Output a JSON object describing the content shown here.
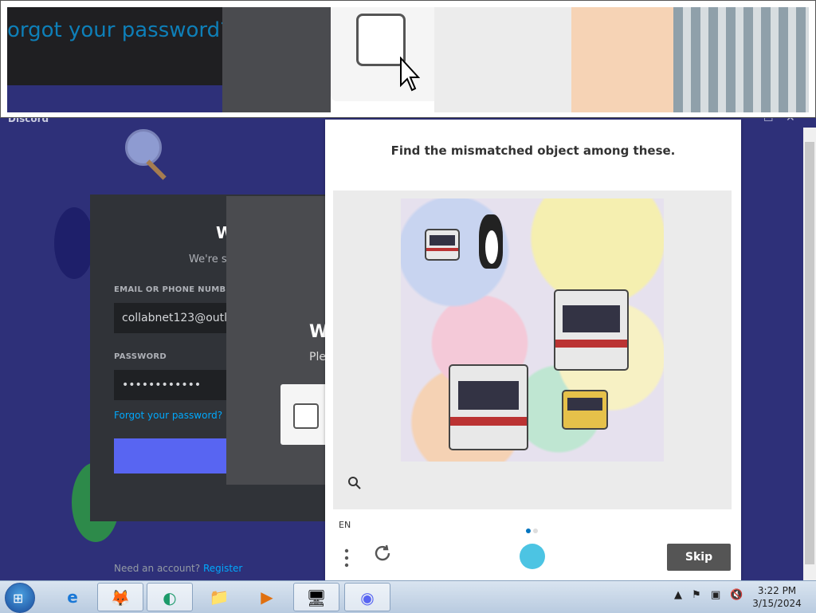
{
  "discord": {
    "window_title": "Discord",
    "login": {
      "title": "W",
      "subtitle": "We're s",
      "email_label": "EMAIL OR PHONE NUMB",
      "email_value": "collabnet123@outl",
      "password_label": "PASSWORD",
      "password_value": "••••••••••••",
      "forgot_link": "Forgot your password?",
      "need_account": "Need an account?",
      "register_link": "Register"
    },
    "hcaptcha_overlay": {
      "title": "W",
      "subtitle": "Ple"
    }
  },
  "zoom_strip": {
    "forgot_text": "orgot your password?"
  },
  "challenge": {
    "prompt": "Find the mismatched object among these.",
    "language": "EN",
    "skip_label": "Skip",
    "zoom_icon": "magnifier-icon",
    "menu_icon": "vertical-dots-icon",
    "refresh_icon": "refresh-icon",
    "logo_icon": "hcaptcha-logo-icon",
    "page_dots": [
      {
        "active": true
      },
      {
        "active": false
      }
    ],
    "accent_color": "#0074bf"
  },
  "taskbar": {
    "items": [
      {
        "name": "internet-explorer",
        "icon": "e"
      },
      {
        "name": "firefox",
        "icon": "🦊"
      },
      {
        "name": "edge",
        "icon": "◐"
      },
      {
        "name": "file-explorer",
        "icon": "📁"
      },
      {
        "name": "media-player",
        "icon": "▶"
      },
      {
        "name": "network-app",
        "icon": "🖥"
      },
      {
        "name": "discord",
        "icon": "◉"
      }
    ],
    "time": "3:22 PM",
    "date": "3/15/2024"
  }
}
